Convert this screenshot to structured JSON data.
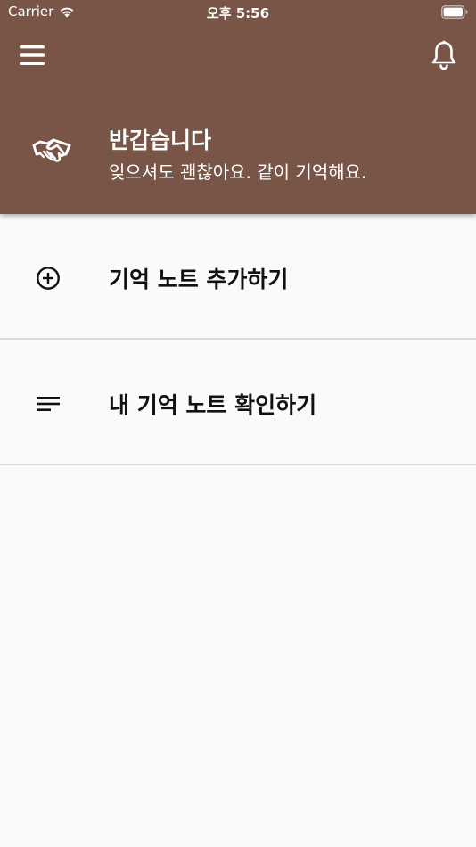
{
  "status_bar": {
    "carrier": "Carrier",
    "time": "오후 5:56",
    "wifi_icon": "wifi-icon",
    "battery_icon": "battery-icon"
  },
  "app_bar": {
    "menu_icon": "hamburger-menu-icon",
    "notification_icon": "bell-icon",
    "background_color": "#795548"
  },
  "greeting": {
    "icon": "handshake-icon",
    "title": "반갑습니다",
    "subtitle": "잊으셔도 괜찮아요. 같이 기억해요."
  },
  "menu": [
    {
      "icon": "add-circle-icon",
      "label": "기억 노트 추가하기"
    },
    {
      "icon": "list-lines-icon",
      "label": "내 기억 노트 확인하기"
    }
  ]
}
